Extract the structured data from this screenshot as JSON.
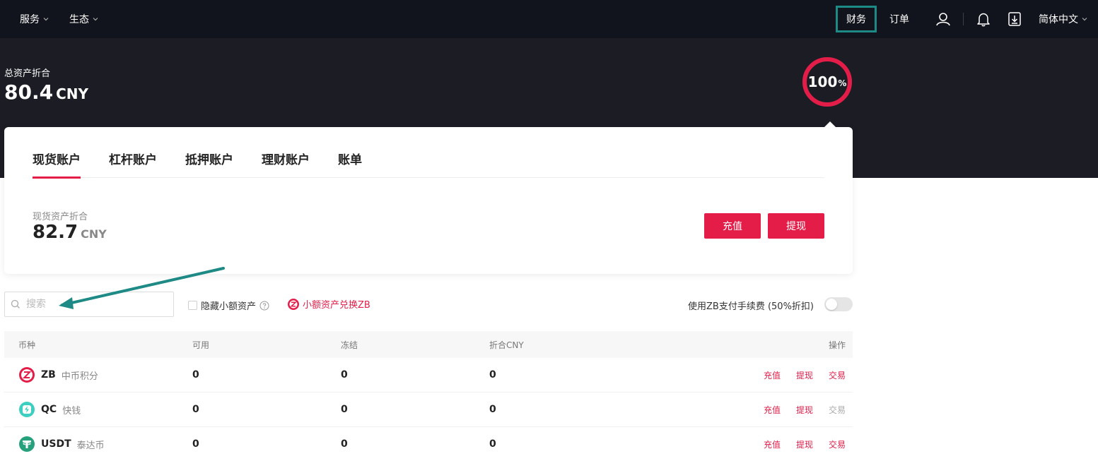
{
  "nav": {
    "left": [
      {
        "label": "服务",
        "icon": "chevron-down-icon"
      },
      {
        "label": "生态",
        "icon": "chevron-down-icon"
      }
    ],
    "finance": "财务",
    "orders": "订单",
    "user_icon": "user-icon",
    "bell_icon": "bell-icon",
    "download_icon": "download-icon",
    "language": "简体中文"
  },
  "summary": {
    "total_label": "总资产折合",
    "total_value": "80.4",
    "total_currency": "CNY",
    "ring_percent": "100",
    "ring_percent_sign": "%",
    "ring_fill": 1.0,
    "ring_color": "#e31d48"
  },
  "tabs": [
    {
      "label": "现货账户",
      "active": true
    },
    {
      "label": "杠杆账户",
      "active": false
    },
    {
      "label": "抵押账户",
      "active": false
    },
    {
      "label": "理财账户",
      "active": false
    },
    {
      "label": "账单",
      "active": false
    }
  ],
  "spot": {
    "label": "现货资产折合",
    "value": "82.7",
    "currency": "CNY",
    "deposit_label": "充值",
    "withdraw_label": "提现"
  },
  "filters": {
    "search_placeholder": "搜索",
    "hide_small_label": "隐藏小额资产",
    "hide_small_checked": false,
    "convert_label": "小额资产兑换ZB",
    "zb_fee_label": "使用ZB支付手续费 (50%折扣)",
    "zb_fee_enabled": false
  },
  "table": {
    "headers": {
      "coin": "币种",
      "available": "可用",
      "frozen": "冻结",
      "cny": "折合CNY",
      "ops": "操作"
    },
    "rows": [
      {
        "symbol": "ZB",
        "name": "中币积分",
        "icon": "zb-coin-icon",
        "available": "0",
        "frozen": "0",
        "cny": "0",
        "deposit": "充值",
        "withdraw": "提现",
        "trade": "交易",
        "trade_enabled": true
      },
      {
        "symbol": "QC",
        "name": "快钱",
        "icon": "qc-coin-icon",
        "available": "0",
        "frozen": "0",
        "cny": "0",
        "deposit": "充值",
        "withdraw": "提现",
        "trade": "交易",
        "trade_enabled": false
      },
      {
        "symbol": "USDT",
        "name": "泰达币",
        "icon": "usdt-coin-icon",
        "available": "0",
        "frozen": "0",
        "cny": "0",
        "deposit": "充值",
        "withdraw": "提现",
        "trade": "交易",
        "trade_enabled": true
      }
    ]
  },
  "colors": {
    "accent": "#e31d48",
    "nav_bg": "#11141c",
    "hero_bg": "#1b1c24",
    "finance_highlight": "#1e8a86",
    "annotation_arrow": "#1e8a86",
    "op_disabled": "#aaaaaa"
  }
}
